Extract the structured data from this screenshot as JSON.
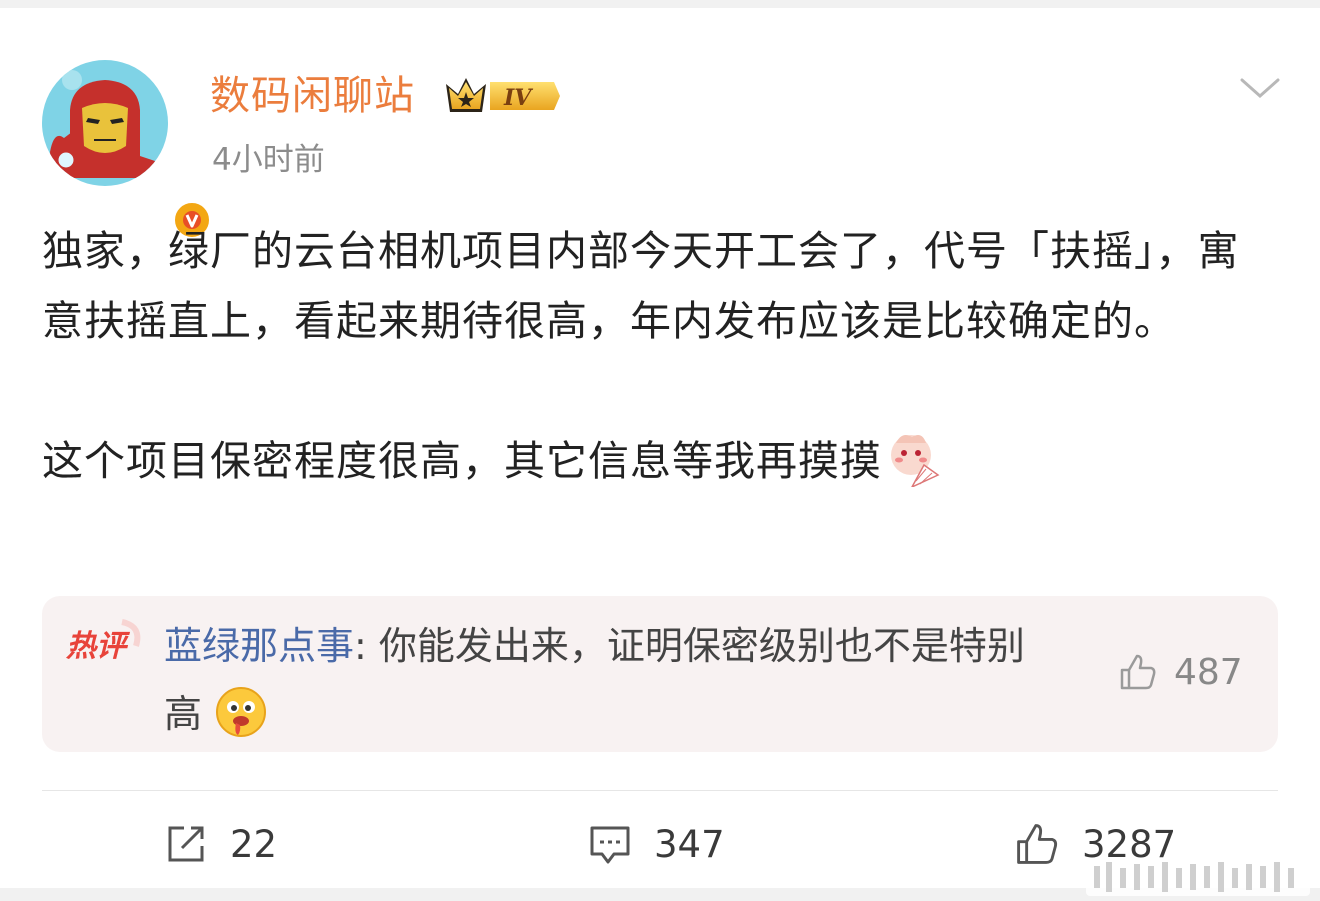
{
  "user": {
    "name": "数码闲聊站",
    "level_badge": "IV",
    "time": "4小时前"
  },
  "post": {
    "paragraph1": "独家，绿厂的云台相机项目内部今天开工会了，代号「扶摇」，寓意扶摇直上，看起来期待很高，年内发布应该是比较确定的。",
    "paragraph2": "这个项目保密程度很高，其它信息等我再摸摸"
  },
  "hot_comment": {
    "tag": "热评",
    "author": "蓝绿那点事",
    "text": ": 你能发出来，证明保密级别也不是特别高",
    "likes": "487"
  },
  "actions": {
    "reposts": "22",
    "comments": "347",
    "likes": "3287"
  },
  "colors": {
    "username": "#eb7d3d",
    "comment_author": "#4a6aa8",
    "hot_tag": "#e8433a",
    "hot_bg": "#f8f2f2"
  },
  "icons": [
    "ironman-avatar",
    "verified-v-icon",
    "crown-vip-icon",
    "chevron-down-icon",
    "fan-emoji-icon",
    "drool-emoji-icon",
    "thumbs-up-icon",
    "repost-icon",
    "comment-icon"
  ]
}
